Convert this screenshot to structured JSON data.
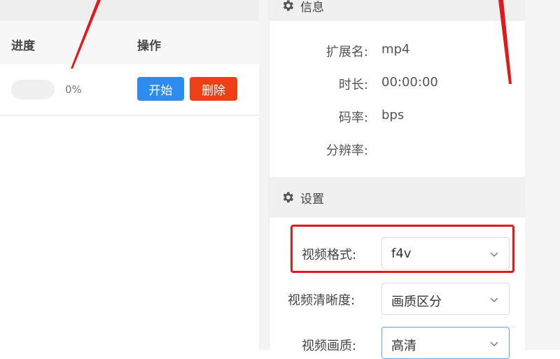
{
  "left": {
    "columns": {
      "progress": "进度",
      "action": "操作"
    },
    "row": {
      "progress_value": 0,
      "progress_text": "0%",
      "start_label": "开始",
      "delete_label": "删除"
    }
  },
  "info": {
    "header": "信息",
    "fields": [
      {
        "label": "扩展名:",
        "value": "mp4"
      },
      {
        "label": "时长:",
        "value": "00:00:00"
      },
      {
        "label": "码率:",
        "value": "bps"
      },
      {
        "label": "分辨率:",
        "value": ""
      }
    ]
  },
  "settings": {
    "header": "设置",
    "video_format": {
      "label": "视频格式:",
      "value": "f4v"
    },
    "video_clarity": {
      "label": "视频清晰度:",
      "value": "画质区分"
    },
    "video_quality": {
      "label": "视频画质:",
      "value": "高清"
    }
  },
  "icons": {
    "settings_gear": "gear-icon",
    "dropdown_chevron": "chevron-down-icon"
  },
  "colors": {
    "start_button": "#2d8cf0",
    "delete_button": "#ed4014",
    "annotation_red": "#e0191b",
    "focus_border": "#5aa7f5"
  }
}
